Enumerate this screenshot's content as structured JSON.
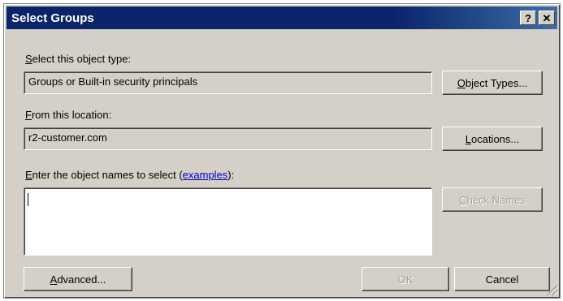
{
  "window": {
    "title": "Select Groups",
    "help_button": "?",
    "close_button": "✕"
  },
  "object_type": {
    "label_prefix": "",
    "label_accel": "S",
    "label_rest": "elect this object type:",
    "value": "Groups or Built-in security principals",
    "button_accel": "O",
    "button_rest": "bject Types..."
  },
  "location": {
    "label_accel": "F",
    "label_rest": "rom this location:",
    "value": "r2-customer.com",
    "button_accel": "L",
    "button_rest": "ocations..."
  },
  "names": {
    "label_accel": "E",
    "label_rest": "nter the object names to select (",
    "link": "examples",
    "label_end": "):",
    "value": ""
  },
  "buttons": {
    "check_names_accel": "C",
    "check_names_rest": "heck Names",
    "advanced_accel": "A",
    "advanced_rest": "dvanced...",
    "ok": "OK",
    "cancel": "Cancel"
  }
}
